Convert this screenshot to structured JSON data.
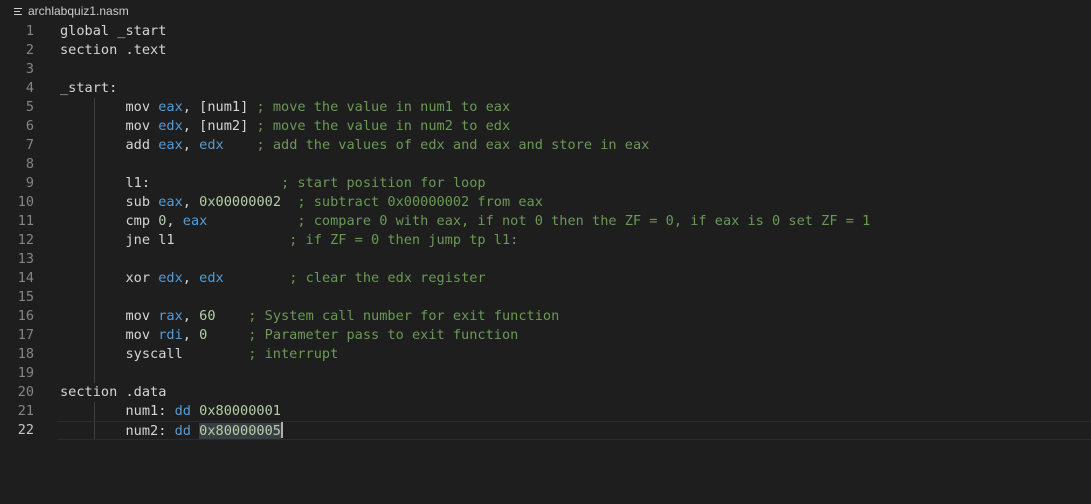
{
  "tab": {
    "filename": "archlabquiz1.nasm",
    "icon": "file-lines-icon"
  },
  "editor": {
    "active_line": 22,
    "lines": [
      {
        "num": "1",
        "parts": [
          {
            "t": "global _start",
            "c": "k"
          }
        ]
      },
      {
        "num": "2",
        "parts": [
          {
            "t": "section .text",
            "c": "k"
          }
        ]
      },
      {
        "num": "3",
        "parts": []
      },
      {
        "num": "4",
        "parts": [
          {
            "t": "_start:",
            "c": "k"
          }
        ]
      },
      {
        "num": "5",
        "parts": [
          {
            "t": "        mov ",
            "c": "k"
          },
          {
            "t": "eax",
            "c": "r"
          },
          {
            "t": ", [num1] ",
            "c": "k"
          },
          {
            "t": "; move the value in num1 to eax",
            "c": "c"
          }
        ]
      },
      {
        "num": "6",
        "parts": [
          {
            "t": "        mov ",
            "c": "k"
          },
          {
            "t": "edx",
            "c": "r"
          },
          {
            "t": ", [num2] ",
            "c": "k"
          },
          {
            "t": "; move the value in num2 to edx",
            "c": "c"
          }
        ]
      },
      {
        "num": "7",
        "parts": [
          {
            "t": "        add ",
            "c": "k"
          },
          {
            "t": "eax",
            "c": "r"
          },
          {
            "t": ", ",
            "c": "k"
          },
          {
            "t": "edx",
            "c": "r"
          },
          {
            "t": "    ",
            "c": "k"
          },
          {
            "t": "; add the values of edx and eax and store in eax",
            "c": "c"
          }
        ]
      },
      {
        "num": "8",
        "parts": []
      },
      {
        "num": "9",
        "parts": [
          {
            "t": "        l1:                ",
            "c": "k"
          },
          {
            "t": "; start position for loop",
            "c": "c"
          }
        ]
      },
      {
        "num": "10",
        "parts": [
          {
            "t": "        sub ",
            "c": "k"
          },
          {
            "t": "eax",
            "c": "r"
          },
          {
            "t": ", ",
            "c": "k"
          },
          {
            "t": "0x00000002",
            "c": "n"
          },
          {
            "t": "  ",
            "c": "k"
          },
          {
            "t": "; subtract 0x00000002 from eax",
            "c": "c"
          }
        ]
      },
      {
        "num": "11",
        "parts": [
          {
            "t": "        cmp ",
            "c": "k"
          },
          {
            "t": "0",
            "c": "n"
          },
          {
            "t": ", ",
            "c": "k"
          },
          {
            "t": "eax",
            "c": "r"
          },
          {
            "t": "           ",
            "c": "k"
          },
          {
            "t": "; compare 0 with eax, if not 0 then the ZF = 0, if eax is 0 set ZF = 1",
            "c": "c"
          }
        ]
      },
      {
        "num": "12",
        "parts": [
          {
            "t": "        jne l1              ",
            "c": "k"
          },
          {
            "t": "; if ZF = 0 then jump tp l1:",
            "c": "c"
          }
        ]
      },
      {
        "num": "13",
        "parts": []
      },
      {
        "num": "14",
        "parts": [
          {
            "t": "        xor ",
            "c": "k"
          },
          {
            "t": "edx",
            "c": "r"
          },
          {
            "t": ", ",
            "c": "k"
          },
          {
            "t": "edx",
            "c": "r"
          },
          {
            "t": "        ",
            "c": "k"
          },
          {
            "t": "; clear the edx register",
            "c": "c"
          }
        ]
      },
      {
        "num": "15",
        "parts": []
      },
      {
        "num": "16",
        "parts": [
          {
            "t": "        mov ",
            "c": "k"
          },
          {
            "t": "rax",
            "c": "r"
          },
          {
            "t": ", ",
            "c": "k"
          },
          {
            "t": "60",
            "c": "n"
          },
          {
            "t": "    ",
            "c": "k"
          },
          {
            "t": "; System call number for exit function",
            "c": "c"
          }
        ]
      },
      {
        "num": "17",
        "parts": [
          {
            "t": "        mov ",
            "c": "k"
          },
          {
            "t": "rdi",
            "c": "r"
          },
          {
            "t": ", ",
            "c": "k"
          },
          {
            "t": "0",
            "c": "n"
          },
          {
            "t": "     ",
            "c": "k"
          },
          {
            "t": "; Parameter pass to exit function",
            "c": "c"
          }
        ]
      },
      {
        "num": "18",
        "parts": [
          {
            "t": "        syscall        ",
            "c": "k"
          },
          {
            "t": "; interrupt",
            "c": "c"
          }
        ]
      },
      {
        "num": "19",
        "parts": []
      },
      {
        "num": "20",
        "parts": [
          {
            "t": "section .data",
            "c": "k"
          }
        ]
      },
      {
        "num": "21",
        "parts": [
          {
            "t": "        num1: ",
            "c": "k"
          },
          {
            "t": "dd",
            "c": "d"
          },
          {
            "t": " ",
            "c": "k"
          },
          {
            "t": "0x80000001",
            "c": "n"
          }
        ]
      },
      {
        "num": "22",
        "parts": [
          {
            "t": "        num2: ",
            "c": "k"
          },
          {
            "t": "dd",
            "c": "d"
          },
          {
            "t": " ",
            "c": "k"
          },
          {
            "t": "0x80000005",
            "c": "n sel"
          }
        ]
      }
    ]
  }
}
